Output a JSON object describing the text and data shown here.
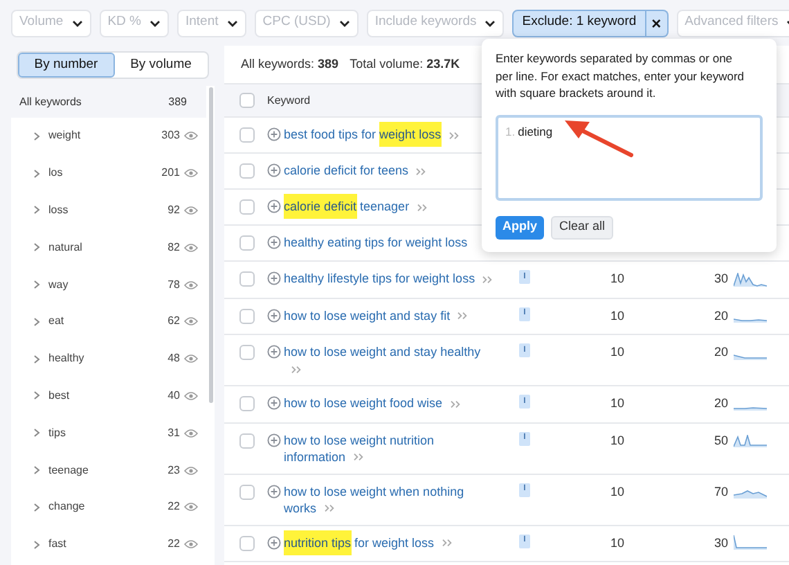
{
  "filters": [
    {
      "label": "Volume",
      "active": false
    },
    {
      "label": "KD %",
      "active": false
    },
    {
      "label": "Intent",
      "active": false
    },
    {
      "label": "CPC (USD)",
      "active": false
    },
    {
      "label": "Include keywords",
      "active": false
    },
    {
      "label": "Exclude: 1 keyword",
      "active": true
    },
    {
      "label": "Advanced filters",
      "active": false
    }
  ],
  "clear_filter": "×",
  "view_tabs": [
    {
      "label": "By number",
      "selected": true
    },
    {
      "label": "By volume",
      "selected": false
    }
  ],
  "groups_header": {
    "label": "All keywords",
    "count": "389"
  },
  "groups": [
    {
      "label": "weight",
      "count": "303"
    },
    {
      "label": "los",
      "count": "201"
    },
    {
      "label": "loss",
      "count": "92"
    },
    {
      "label": "natural",
      "count": "82"
    },
    {
      "label": "way",
      "count": "78"
    },
    {
      "label": "eat",
      "count": "62"
    },
    {
      "label": "healthy",
      "count": "48"
    },
    {
      "label": "best",
      "count": "40"
    },
    {
      "label": "tips",
      "count": "31"
    },
    {
      "label": "teenage",
      "count": "23"
    },
    {
      "label": "change",
      "count": "22"
    },
    {
      "label": "fast",
      "count": "22"
    }
  ],
  "summary": {
    "keywords_label": "All keywords:",
    "keywords": "389",
    "volume_label": "Total volume:",
    "volume": "23.7K"
  },
  "table": {
    "columns": [
      "Keyword"
    ],
    "select_all_checked": false,
    "rows": [
      {
        "keyword": [
          {
            "text": "best food tips for ",
            "highlight": false
          },
          {
            "text": "weight loss",
            "highlight": true
          }
        ],
        "serp_link": true,
        "checked": false
      },
      {
        "keyword": [
          {
            "text": "calorie deficit for teens",
            "highlight": false
          }
        ],
        "serp_link": true,
        "checked": false
      },
      {
        "keyword": [
          {
            "text": "calorie deficit",
            "highlight": true
          },
          {
            "text": " teenager",
            "highlight": false
          }
        ],
        "serp_link": true,
        "checked": false
      },
      {
        "keyword": [
          {
            "text": "healthy eating tips for weight loss",
            "highlight": false
          }
        ],
        "serp_link": false,
        "checked": false
      },
      {
        "keyword": [
          {
            "text": "healthy lifestyle tips for weight loss",
            "highlight": false
          }
        ],
        "serp_link": true,
        "checked": false,
        "intent": "I",
        "volume": "10",
        "kd": "30"
      },
      {
        "keyword": [
          {
            "text": "how to lose weight and stay fit",
            "highlight": false
          }
        ],
        "serp_link": true,
        "checked": false,
        "intent": "I",
        "volume": "10",
        "kd": "20"
      },
      {
        "keyword": [
          {
            "text": "how to lose weight and stay healthy",
            "highlight": false
          }
        ],
        "serp_link": true,
        "checked": false,
        "intent": "I",
        "volume": "10",
        "kd": "20"
      },
      {
        "keyword": [
          {
            "text": "how to lose weight food wise",
            "highlight": false
          }
        ],
        "serp_link": true,
        "checked": false,
        "intent": "I",
        "volume": "10",
        "kd": "20"
      },
      {
        "keyword": [
          {
            "text": "how to lose weight nutrition information",
            "highlight": false
          }
        ],
        "serp_link": true,
        "checked": false,
        "intent": "I",
        "volume": "10",
        "kd": "50"
      },
      {
        "keyword": [
          {
            "text": "how to lose weight when nothing works",
            "highlight": false
          }
        ],
        "serp_link": true,
        "checked": false,
        "intent": "I",
        "volume": "10",
        "kd": "70"
      },
      {
        "keyword": [
          {
            "text": "nutrition tips",
            "highlight": true
          },
          {
            "text": " for weight loss",
            "highlight": false
          }
        ],
        "serp_link": true,
        "checked": false,
        "intent": "I",
        "volume": "10",
        "kd": "30"
      }
    ]
  },
  "exclude_popup": {
    "hint": "Enter keywords separated by commas or one per line. For exact matches, enter your keyword with square brackets around it.",
    "lines": [
      {
        "number": "1.",
        "text": "dieting"
      }
    ],
    "apply": "Apply",
    "clear": "Clear all"
  }
}
